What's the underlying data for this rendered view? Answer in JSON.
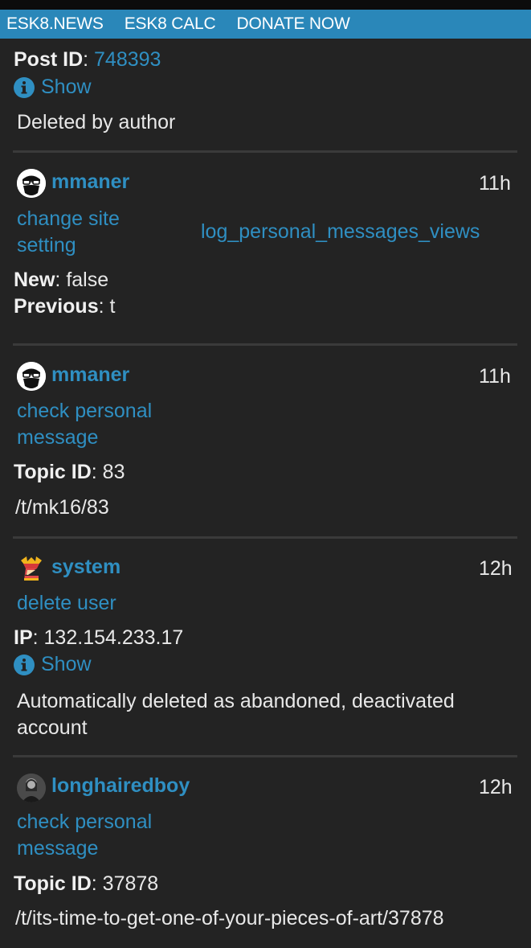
{
  "nav": {
    "items": [
      "ESK8.NEWS",
      "ESK8 CALC",
      "DONATE NOW"
    ]
  },
  "entry1": {
    "post_id_label": "Post ID",
    "post_id_value": "748393",
    "show_label": "Show",
    "details": "Deleted by author"
  },
  "entry2": {
    "username": "mmaner",
    "time": "11h",
    "action_line1": "change site",
    "action_line2": "setting",
    "subject": "log_personal_messages_views",
    "new_label": "New",
    "new_value": "false",
    "previous_label": "Previous",
    "previous_value": "t"
  },
  "entry3": {
    "username": "mmaner",
    "time": "11h",
    "action_line1": "check personal",
    "action_line2": "message",
    "topic_label": "Topic ID",
    "topic_value": "83",
    "path": "/t/mk16/83"
  },
  "entry4": {
    "username": "system",
    "time": "12h",
    "action": "delete user",
    "ip_label": "IP",
    "ip_value": "132.154.233.17",
    "show_label": "Show",
    "details_line1": "Automatically deleted as abandoned, deactivated",
    "details_line2": "account"
  },
  "entry5": {
    "username": "longhairedboy",
    "time": "12h",
    "action_line1": "check personal",
    "action_line2": "message",
    "topic_label": "Topic ID",
    "topic_value": "37878",
    "path": "/t/its-time-to-get-one-of-your-pieces-of-art/37878"
  },
  "colors": {
    "nav_bg": "#2a87b9",
    "link": "#2f8fc2",
    "background": "#232323",
    "separator": "#3a3a3a"
  }
}
